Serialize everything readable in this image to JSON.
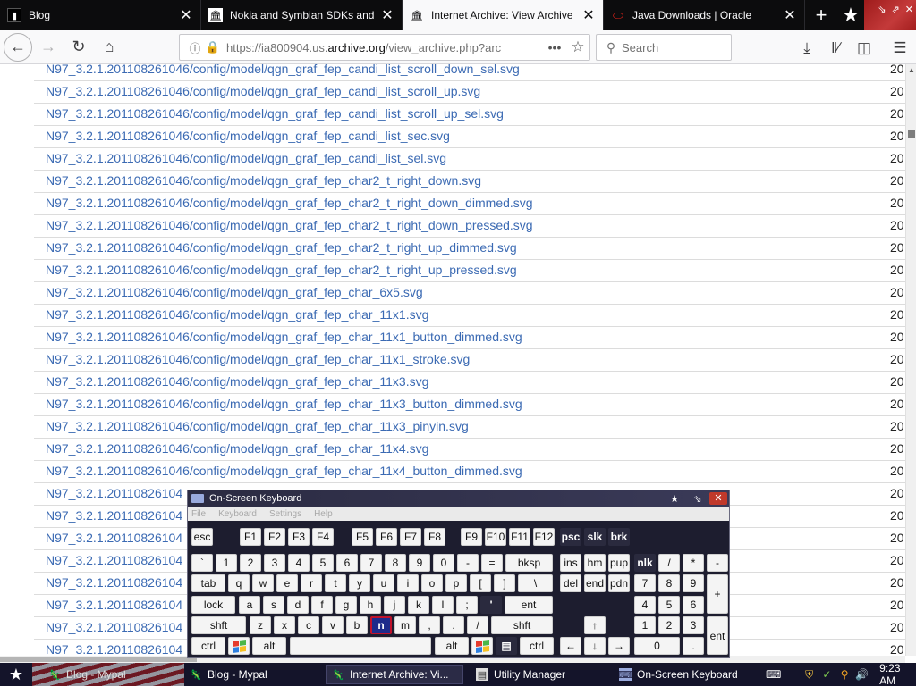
{
  "tabs": [
    {
      "title": "Blog",
      "icon": "terminal-icon",
      "active": false
    },
    {
      "title": "Nokia and Symbian SDKs and Dev",
      "icon": "archive-icon",
      "active": false
    },
    {
      "title": "Internet Archive: View Archive",
      "icon": "archive-icon",
      "active": true
    },
    {
      "title": "Java Downloads | Oracle",
      "icon": "oracle-icon",
      "active": false
    }
  ],
  "toolbar": {
    "url_prefix": "https://ia800904.us.",
    "url_domain": "archive.org",
    "url_suffix": "/view_archive.php?arc",
    "search_placeholder": "Search"
  },
  "listing": {
    "date_prefix": "20",
    "rows": [
      "N97_3.2.1.201108261046/config/model/qgn_graf_fep_candi_list_scroll_down_sel.svg",
      "N97_3.2.1.201108261046/config/model/qgn_graf_fep_candi_list_scroll_up.svg",
      "N97_3.2.1.201108261046/config/model/qgn_graf_fep_candi_list_scroll_up_sel.svg",
      "N97_3.2.1.201108261046/config/model/qgn_graf_fep_candi_list_sec.svg",
      "N97_3.2.1.201108261046/config/model/qgn_graf_fep_candi_list_sel.svg",
      "N97_3.2.1.201108261046/config/model/qgn_graf_fep_char2_t_right_down.svg",
      "N97_3.2.1.201108261046/config/model/qgn_graf_fep_char2_t_right_down_dimmed.svg",
      "N97_3.2.1.201108261046/config/model/qgn_graf_fep_char2_t_right_down_pressed.svg",
      "N97_3.2.1.201108261046/config/model/qgn_graf_fep_char2_t_right_up_dimmed.svg",
      "N97_3.2.1.201108261046/config/model/qgn_graf_fep_char2_t_right_up_pressed.svg",
      "N97_3.2.1.201108261046/config/model/qgn_graf_fep_char_6x5.svg",
      "N97_3.2.1.201108261046/config/model/qgn_graf_fep_char_11x1.svg",
      "N97_3.2.1.201108261046/config/model/qgn_graf_fep_char_11x1_button_dimmed.svg",
      "N97_3.2.1.201108261046/config/model/qgn_graf_fep_char_11x1_stroke.svg",
      "N97_3.2.1.201108261046/config/model/qgn_graf_fep_char_11x3.svg",
      "N97_3.2.1.201108261046/config/model/qgn_graf_fep_char_11x3_button_dimmed.svg",
      "N97_3.2.1.201108261046/config/model/qgn_graf_fep_char_11x3_pinyin.svg",
      "N97_3.2.1.201108261046/config/model/qgn_graf_fep_char_11x4.svg",
      "N97_3.2.1.201108261046/config/model/qgn_graf_fep_char_11x4_button_dimmed.svg",
      "N97_3.2.1.20110826104",
      "N97_3.2.1.20110826104",
      "N97_3.2.1.20110826104",
      "N97_3.2.1.20110826104",
      "N97_3.2.1.20110826104",
      "N97_3.2.1.20110826104",
      "N97_3.2.1.20110826104",
      "N97_3.2.1.20110826104"
    ]
  },
  "osk": {
    "title": "On-Screen Keyboard",
    "menu": [
      "File",
      "Keyboard",
      "Settings",
      "Help"
    ],
    "selected_key": "n"
  },
  "taskbar": {
    "items": [
      "Blog - Mypal",
      "Blog - Mypal",
      "Internet Archive: Vi...",
      "Utility Manager",
      "On-Screen Keyboard"
    ],
    "clock": "9:23 AM"
  },
  "colors": {
    "link": "#3b6ab3",
    "tab_bar": "#0c0c0d",
    "taskbar": "#14142a",
    "osk_bg": "#1d1d2f",
    "selected_key_border": "#c0122b"
  }
}
